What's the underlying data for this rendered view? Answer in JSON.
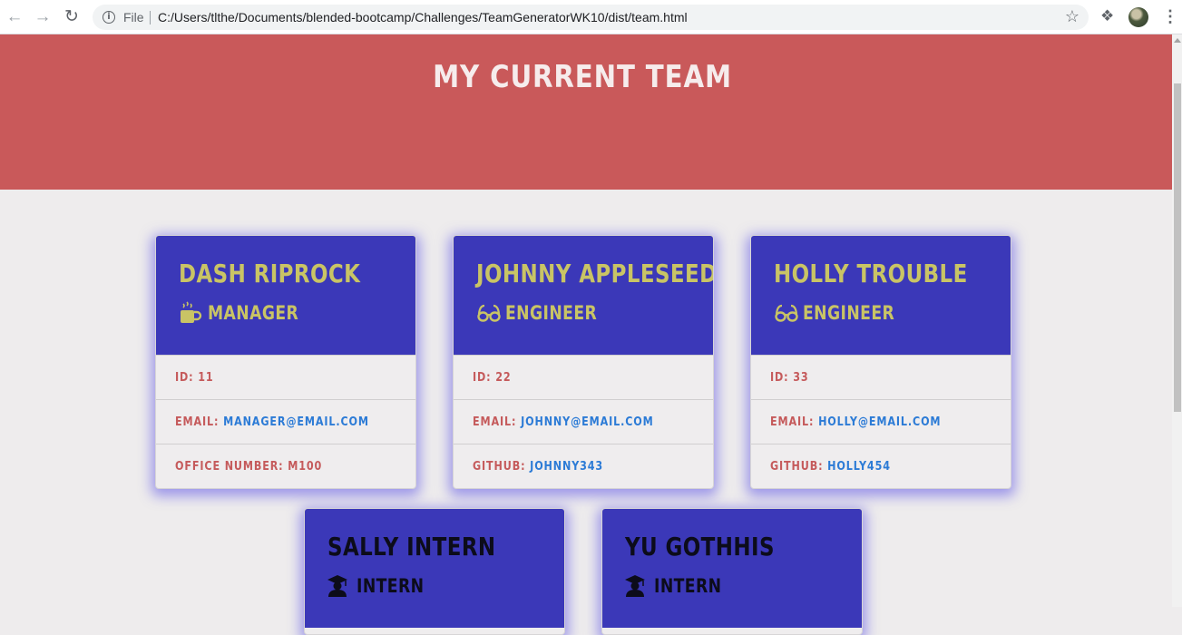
{
  "browser": {
    "file_label": "File",
    "url": "C:/Users/tlthe/Documents/blended-bootcamp/Challenges/TeamGeneratorWK10/dist/team.html"
  },
  "page": {
    "title": "MY CURRENT TEAM"
  },
  "colors": {
    "header_bg": "#c9595a",
    "card_head_bg": "#3b38b8",
    "name_color": "#c9c465",
    "label_color": "#c55a5b",
    "link_color": "#2c7bd6"
  },
  "cards": [
    {
      "name": "DASH RIPROCK",
      "role": "MANAGER",
      "role_icon": "mug-icon",
      "rows": [
        {
          "label": "ID:",
          "value": "11"
        },
        {
          "label": "EMAIL:",
          "value": "MANAGER@EMAIL.COM"
        },
        {
          "label": "OFFICE NUMBER:",
          "value": "M100"
        }
      ]
    },
    {
      "name": "JOHNNY APPLESEED",
      "role": "ENGINEER",
      "role_icon": "glasses-icon",
      "rows": [
        {
          "label": "ID:",
          "value": "22"
        },
        {
          "label": "EMAIL:",
          "value": "JOHNNY@EMAIL.COM"
        },
        {
          "label": "GITHUB:",
          "value": "JOHNNY343"
        }
      ]
    },
    {
      "name": "HOLLY TROUBLE",
      "role": "ENGINEER",
      "role_icon": "glasses-icon",
      "rows": [
        {
          "label": "ID:",
          "value": "33"
        },
        {
          "label": "EMAIL:",
          "value": "HOLLY@EMAIL.COM"
        },
        {
          "label": "GITHUB:",
          "value": "HOLLY454"
        }
      ]
    },
    {
      "name": "SALLY INTERN",
      "role": "INTERN",
      "role_icon": "graduate-icon"
    },
    {
      "name": "YU GOTHHIS",
      "role": "INTERN",
      "role_icon": "graduate-icon"
    }
  ]
}
